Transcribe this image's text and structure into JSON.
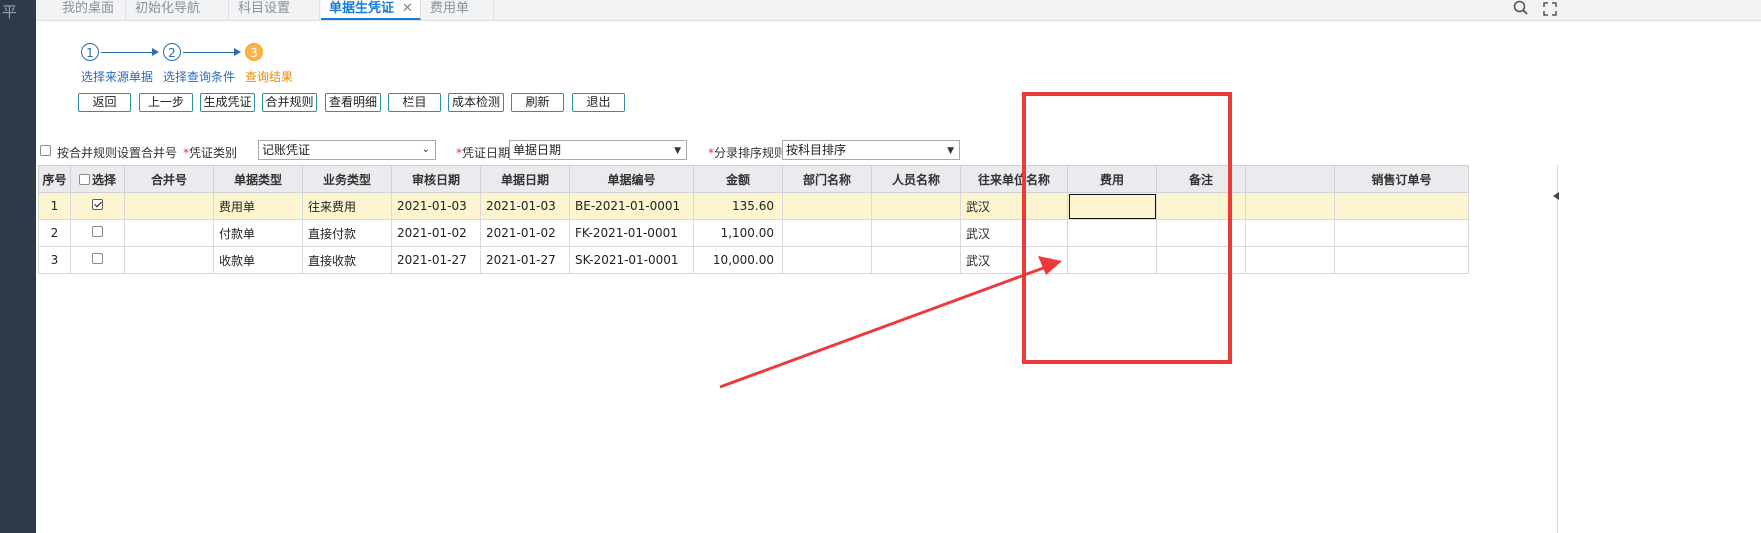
{
  "tabs": [
    {
      "label": "我的桌面",
      "active": false
    },
    {
      "label": "初始化导航",
      "active": false
    },
    {
      "label": "科目设置",
      "active": false
    },
    {
      "label": "单据生凭证",
      "active": true
    },
    {
      "label": "费用单",
      "active": false
    }
  ],
  "tab_close_glyph": "✕",
  "toolbar_icons": [
    "search-icon",
    "fullscreen-icon"
  ],
  "steps": [
    {
      "number": "1",
      "label": "选择来源单据",
      "state": "done"
    },
    {
      "number": "2",
      "label": "选择查询条件",
      "state": "done"
    },
    {
      "number": "3",
      "label": "查询结果",
      "state": "current"
    }
  ],
  "buttons": [
    "返回",
    "上一步",
    "生成凭证",
    "合并规则",
    "查看明细",
    "栏目",
    "成本检测",
    "刷新",
    "退出"
  ],
  "filters": {
    "merge_checkbox_label": "按合并规则设置合并号",
    "merge_checked": false,
    "voucher_type_label": "凭证类别",
    "voucher_type_value": "记账凭证",
    "voucher_date_label": "凭证日期",
    "voucher_date_value": "单据日期",
    "sort_rule_label": "分录排序规则",
    "sort_rule_value": "按科目排序",
    "required_mark": "*"
  },
  "grid": {
    "columns": [
      "序号",
      "选择",
      "合并号",
      "单据类型",
      "业务类型",
      "审核日期",
      "单据日期",
      "单据编号",
      "金额",
      "部门名称",
      "人员名称",
      "往来单位名称",
      "费用",
      "备注",
      "",
      "销售订单号"
    ],
    "rows": [
      {
        "index": "1",
        "checked": true,
        "merge_no": "",
        "doc_type": "费用单",
        "biz_type": "往来费用",
        "audit_date": "2021-01-03",
        "doc_date": "2021-01-03",
        "doc_no": "BE-2021-01-0001",
        "amount": "135.60",
        "dept": "",
        "person": "",
        "partner": "武汉",
        "expense": "",
        "remark": "",
        "blank": "",
        "sales_order": ""
      },
      {
        "index": "2",
        "checked": false,
        "merge_no": "",
        "doc_type": "付款单",
        "biz_type": "直接付款",
        "audit_date": "2021-01-02",
        "doc_date": "2021-01-02",
        "doc_no": "FK-2021-01-0001",
        "amount": "1,100.00",
        "dept": "",
        "person": "",
        "partner": "武汉",
        "expense": "",
        "remark": "",
        "blank": "",
        "sales_order": ""
      },
      {
        "index": "3",
        "checked": false,
        "merge_no": "",
        "doc_type": "收款单",
        "biz_type": "直接收款",
        "audit_date": "2021-01-27",
        "doc_date": "2021-01-27",
        "doc_no": "SK-2021-01-0001",
        "amount": "10,000.00",
        "dept": "",
        "person": "",
        "partner": "武汉",
        "expense": "",
        "remark": "",
        "blank": "",
        "sales_order": ""
      }
    ],
    "selected_row": 0
  },
  "left_strip_glyph": "平",
  "colors": {
    "accent": "#1a7bd8",
    "step_current": "#f5a623",
    "annotation_red": "#ec3a3a",
    "selected_row_bg": "#fdf5cf",
    "sidebar_bg": "#2e3a47"
  }
}
